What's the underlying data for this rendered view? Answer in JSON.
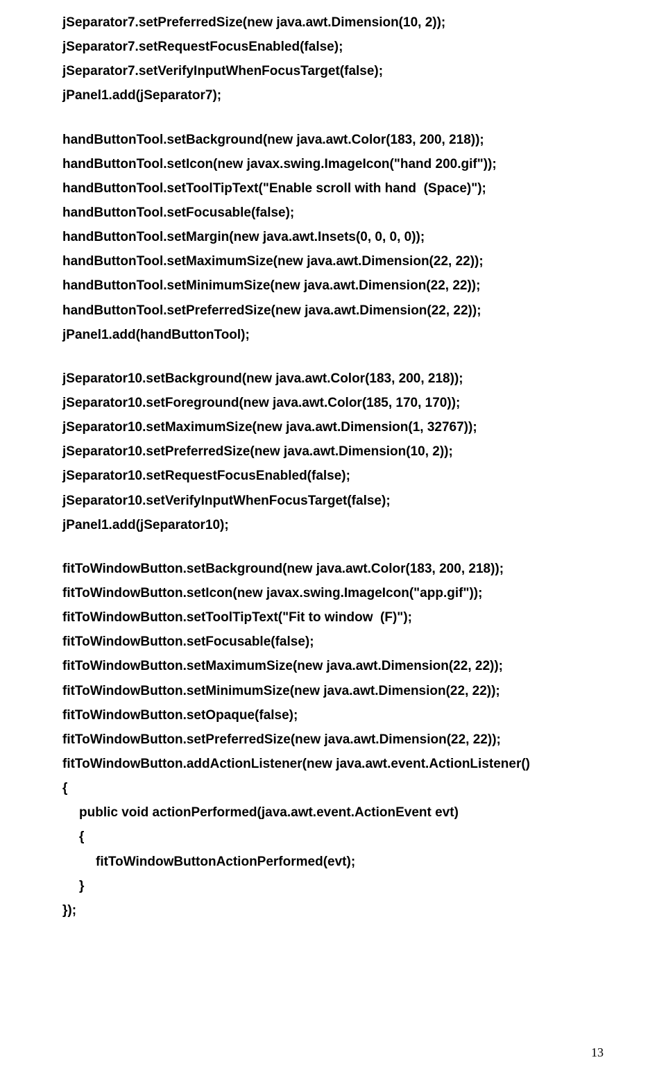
{
  "lines": [
    {
      "text": "jSeparator7.setPreferredSize(new java.awt.Dimension(10, 2));",
      "indent": 0
    },
    {
      "text": "jSeparator7.setRequestFocusEnabled(false);",
      "indent": 0
    },
    {
      "text": "jSeparator7.setVerifyInputWhenFocusTarget(false);",
      "indent": 0
    },
    {
      "text": "jPanel1.add(jSeparator7);",
      "indent": 0
    },
    {
      "gap": true
    },
    {
      "text": "handButtonTool.setBackground(new java.awt.Color(183, 200, 218));",
      "indent": 0
    },
    {
      "text": "handButtonTool.setIcon(new javax.swing.ImageIcon(\"hand 200.gif\"));",
      "indent": 0
    },
    {
      "text": "handButtonTool.setToolTipText(\"Enable scroll with hand  (Space)\");",
      "indent": 0
    },
    {
      "text": "handButtonTool.setFocusable(false);",
      "indent": 0
    },
    {
      "text": "handButtonTool.setMargin(new java.awt.Insets(0, 0, 0, 0));",
      "indent": 0
    },
    {
      "text": "handButtonTool.setMaximumSize(new java.awt.Dimension(22, 22));",
      "indent": 0
    },
    {
      "text": "handButtonTool.setMinimumSize(new java.awt.Dimension(22, 22));",
      "indent": 0
    },
    {
      "text": "handButtonTool.setPreferredSize(new java.awt.Dimension(22, 22));",
      "indent": 0
    },
    {
      "text": "jPanel1.add(handButtonTool);",
      "indent": 0
    },
    {
      "gap": true
    },
    {
      "text": "jSeparator10.setBackground(new java.awt.Color(183, 200, 218));",
      "indent": 0
    },
    {
      "text": "jSeparator10.setForeground(new java.awt.Color(185, 170, 170));",
      "indent": 0
    },
    {
      "text": "jSeparator10.setMaximumSize(new java.awt.Dimension(1, 32767));",
      "indent": 0
    },
    {
      "text": "jSeparator10.setPreferredSize(new java.awt.Dimension(10, 2));",
      "indent": 0
    },
    {
      "text": "jSeparator10.setRequestFocusEnabled(false);",
      "indent": 0
    },
    {
      "text": "jSeparator10.setVerifyInputWhenFocusTarget(false);",
      "indent": 0
    },
    {
      "text": "jPanel1.add(jSeparator10);",
      "indent": 0
    },
    {
      "gap": true
    },
    {
      "text": "fitToWindowButton.setBackground(new java.awt.Color(183, 200, 218));",
      "indent": 0
    },
    {
      "text": "fitToWindowButton.setIcon(new javax.swing.ImageIcon(\"app.gif\"));",
      "indent": 0
    },
    {
      "text": "fitToWindowButton.setToolTipText(\"Fit to window  (F)\");",
      "indent": 0
    },
    {
      "text": "fitToWindowButton.setFocusable(false);",
      "indent": 0
    },
    {
      "text": "fitToWindowButton.setMaximumSize(new java.awt.Dimension(22, 22));",
      "indent": 0
    },
    {
      "text": "fitToWindowButton.setMinimumSize(new java.awt.Dimension(22, 22));",
      "indent": 0
    },
    {
      "text": "fitToWindowButton.setOpaque(false);",
      "indent": 0
    },
    {
      "text": "fitToWindowButton.setPreferredSize(new java.awt.Dimension(22, 22));",
      "indent": 0
    },
    {
      "text": "fitToWindowButton.addActionListener(new java.awt.event.ActionListener()",
      "indent": 0
    },
    {
      "text": "{",
      "indent": 0
    },
    {
      "text": "public void actionPerformed(java.awt.event.ActionEvent evt)",
      "indent": 1
    },
    {
      "text": "{",
      "indent": 1
    },
    {
      "text": "fitToWindowButtonActionPerformed(evt);",
      "indent": 2
    },
    {
      "text": "}",
      "indent": 1
    },
    {
      "text": "});",
      "indent": 0
    }
  ],
  "page_number": "13"
}
